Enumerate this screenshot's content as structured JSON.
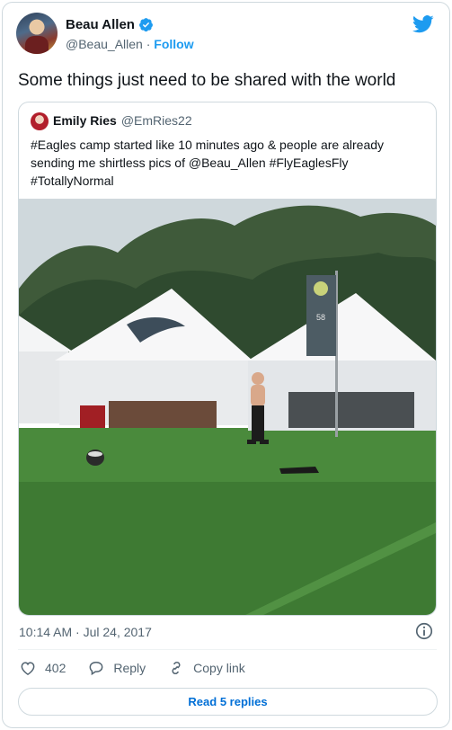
{
  "author": {
    "name": "Beau Allen",
    "handle": "@Beau_Allen",
    "separator": "·",
    "follow_label": "Follow"
  },
  "tweet": {
    "text": "Some things just need to be shared with the world"
  },
  "quoted": {
    "name": "Emily Ries",
    "handle": "@EmRies22",
    "text": "#Eagles camp started like 10 minutes ago & people are already sending me shirtless pics of @Beau_Allen #FlyEaglesFly #TotallyNormal",
    "banner_number": "58"
  },
  "meta": {
    "timestamp": "10:14 AM · Jul 24, 2017"
  },
  "actions": {
    "like_count": "402",
    "reply_label": "Reply",
    "copy_label": "Copy link"
  },
  "read_replies_label": "Read 5 replies",
  "colors": {
    "brand": "#1d9bf0",
    "link_button": "#006fd6",
    "muted_text": "#536471",
    "border": "#cfd9de"
  },
  "icons": [
    "verified-badge-icon",
    "twitter-bird-icon",
    "info-icon",
    "heart-icon",
    "reply-bubble-icon",
    "link-icon"
  ]
}
